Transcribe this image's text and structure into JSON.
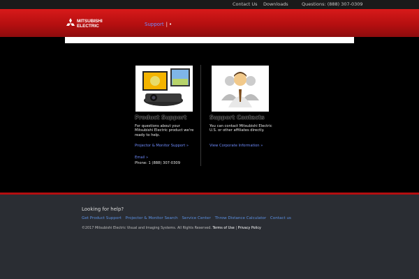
{
  "topbar": {
    "contact_us": "Contact Us",
    "downloads": "Downloads",
    "questions": "Questions: (888) 307-0309"
  },
  "header": {
    "logo_line1": "MITSUBISHI",
    "logo_line2": "ELECTRIC",
    "nav_support": "Support",
    "nav_separator": "|",
    "nav_dot": "•"
  },
  "columns": [
    {
      "heading": "Product Support",
      "image_icon": "projector-and-monitor-image",
      "paragraph": "For questions about your Mitsubishi Electric product we're ready to help.",
      "link1": "Projector & Monitor Support »",
      "link2": "Email »",
      "phone": "Phone: 1 (888) 307-0309"
    },
    {
      "heading": "Support Contacts",
      "image_icon": "business-people-image",
      "paragraph": "You can contact Mitsubishi Electric U.S. or other affiliates directly.",
      "link1": "View Corporate Information »"
    }
  ],
  "footer": {
    "help_heading": "Looking for help?",
    "links": [
      "Get Product Support",
      "Projector & Monitor Search",
      "Service Center",
      "Throw Distance Calculator",
      "Contact us"
    ],
    "copyright": "©2017 Mitsubishi Electric Visual and Imaging Systems. All Rights Reserved.",
    "terms": "Terms of Use",
    "divider": "|",
    "privacy": "Privacy Policy"
  },
  "colors": {
    "accent_red": "#b50f10",
    "link_blue": "#6f8cff",
    "footer_bg": "#2a2d33"
  }
}
